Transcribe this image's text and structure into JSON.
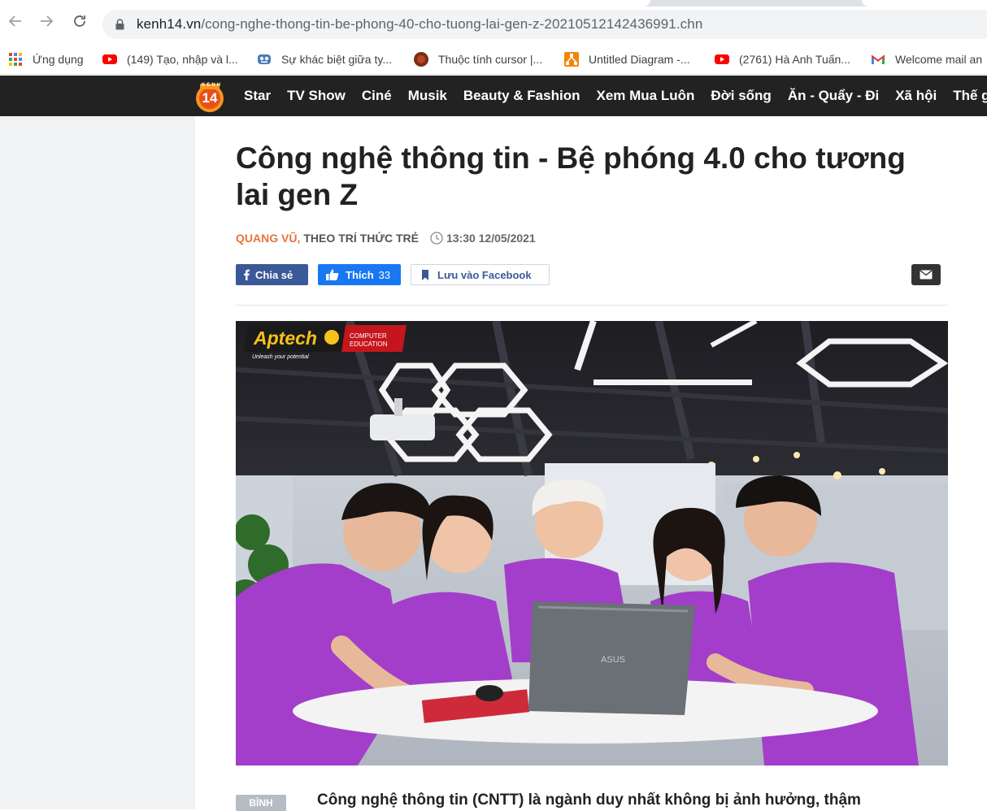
{
  "browser": {
    "url_host": "kenh14.vn",
    "url_path": "/cong-nghe-thong-tin-be-phong-40-cho-tuong-lai-gen-z-20210512142436991.chn",
    "back_icon": "arrow-left-icon",
    "forward_icon": "arrow-right-icon",
    "reload_icon": "reload-icon"
  },
  "bookmarks": [
    {
      "label": "Ứng dụng",
      "icon": "apps-grid-icon"
    },
    {
      "label": "(149) Tạo, nhập và l...",
      "icon": "youtube-icon"
    },
    {
      "label": "Sự khác biệt giữa ty...",
      "icon": "robot-icon"
    },
    {
      "label": "Thuộc tính cursor |...",
      "icon": "wix-icon"
    },
    {
      "label": "Untitled Diagram -...",
      "icon": "drawio-icon"
    },
    {
      "label": "(2761) Hà Anh Tuấn...",
      "icon": "youtube-icon"
    },
    {
      "label": "Welcome mail an",
      "icon": "gmail-icon"
    }
  ],
  "site": {
    "logo_text": "14",
    "logo_sub": "KENH",
    "nav": [
      "Star",
      "TV Show",
      "Ciné",
      "Musik",
      "Beauty & Fashion",
      "Xem Mua Luôn",
      "Đời sống",
      "Ăn - Quẩy - Đi",
      "Xã hội",
      "Thế gi"
    ]
  },
  "article": {
    "title": "Công nghệ thông tin - Bệ phóng 4.0 cho tương lai gen Z",
    "author": "QUANG VŨ,",
    "source_pre": "THEO",
    "source": "TRÍ THỨC TRẺ",
    "time": "13:30 12/05/2021",
    "share_label": "Chia sẻ",
    "like_label": "Thích",
    "like_count": "33",
    "save_label": "Lưu vào Facebook",
    "photo_brand": "Aptech",
    "photo_brand_sub1": "COMPUTER",
    "photo_brand_sub2": "EDUCATION",
    "photo_brand_tagline": "Unleash your potential",
    "laptop_brand": "ASUS",
    "tag": "BÌNH",
    "lead": "Công nghệ thông tin (CNTT) là ngành duy nhất không bị ảnh hưởng, thậm"
  },
  "colors": {
    "nav_bg": "#222222",
    "author": "#e8743b",
    "facebook": "#3b5998",
    "like": "#1877f2"
  }
}
